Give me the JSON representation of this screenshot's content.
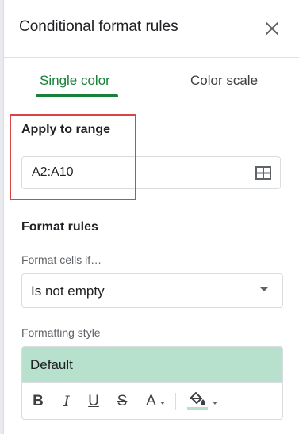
{
  "panel": {
    "title": "Conditional format rules",
    "close_icon": "close-icon"
  },
  "tabs": [
    {
      "label": "Single color",
      "active": true
    },
    {
      "label": "Color scale",
      "active": false
    }
  ],
  "range": {
    "label": "Apply to range",
    "value": "A2:A10",
    "icon": "grid-select-icon"
  },
  "format_rules": {
    "label": "Format rules",
    "condition_label": "Format cells if…",
    "condition_value": "Is not empty"
  },
  "formatting_style": {
    "label": "Formatting style",
    "preview_text": "Default",
    "preview_color": "#b7e1cd",
    "toolbar": {
      "bold": "B",
      "italic": "I",
      "underline": "U",
      "strikethrough": "S",
      "text_color": "A",
      "fill_icon": "fill-color-icon",
      "fill_color": "#b7e1cd"
    }
  },
  "colors": {
    "accent": "#188038",
    "highlight": "#d94343"
  }
}
